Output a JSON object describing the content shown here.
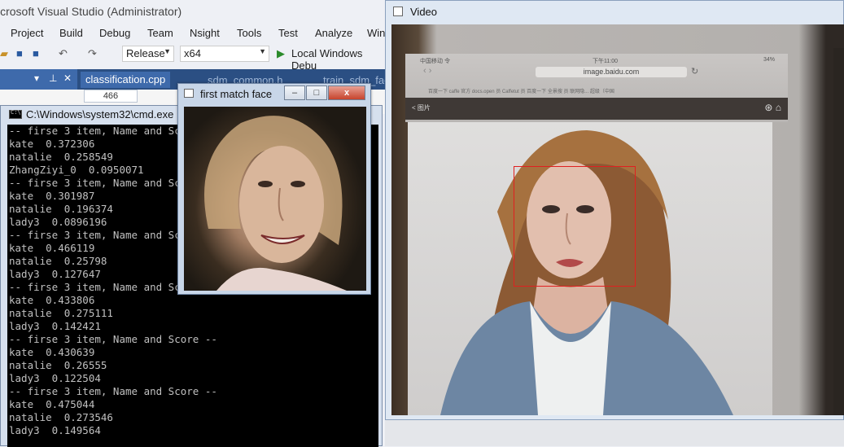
{
  "vs": {
    "title": "icrosoft Visual Studio (Administrator)",
    "menu": [
      "Project",
      "Build",
      "Debug",
      "Team",
      "Nsight",
      "Tools",
      "Test",
      "Analyze",
      "Win"
    ],
    "toolbar": {
      "config": "Release",
      "platform": "x64",
      "run_target": "Local Windows Debu"
    },
    "tabs": [
      "classification.cpp",
      "sdm_common.h",
      "train_sdm_fac"
    ],
    "line_number": "466"
  },
  "cmd": {
    "title": "C:\\Windows\\system32\\cmd.exe",
    "lines": [
      "-- firse 3 item, Name and Score --",
      "kate  0.372306",
      "natalie  0.258549",
      "ZhangZiyi_0  0.0950071",
      "-- firse 3 item, Name and Score --",
      "kate  0.301987",
      "natalie  0.196374",
      "lady3  0.0896196",
      "-- firse 3 item, Name and Score --",
      "kate  0.466119",
      "natalie  0.25798",
      "lady3  0.127647",
      "-- firse 3 item, Name and Score --",
      "kate  0.433806",
      "natalie  0.275111",
      "lady3  0.142421",
      "-- firse 3 item, Name and Score --",
      "kate  0.430639",
      "natalie  0.26555",
      "lady3  0.122504",
      "-- firse 3 item, Name and Score --",
      "kate  0.475044",
      "natalie  0.273546",
      "lady3  0.149564"
    ]
  },
  "face_window": {
    "title": "first match face",
    "buttons": {
      "minimize": "–",
      "maximize": "□",
      "close": "x"
    }
  },
  "video": {
    "title": "Video",
    "ipad": {
      "url": "image.baidu.com",
      "status": "中国移动 令",
      "time": "下午11:00",
      "battery": "34%",
      "back": "< 图片",
      "bookmarks": "百度一下   caffe 官方   docs.open 员   Caffetut 员   百度一下   全景搜 员   联网隐...   超级（中国"
    },
    "face_box_color": "#e02020"
  }
}
